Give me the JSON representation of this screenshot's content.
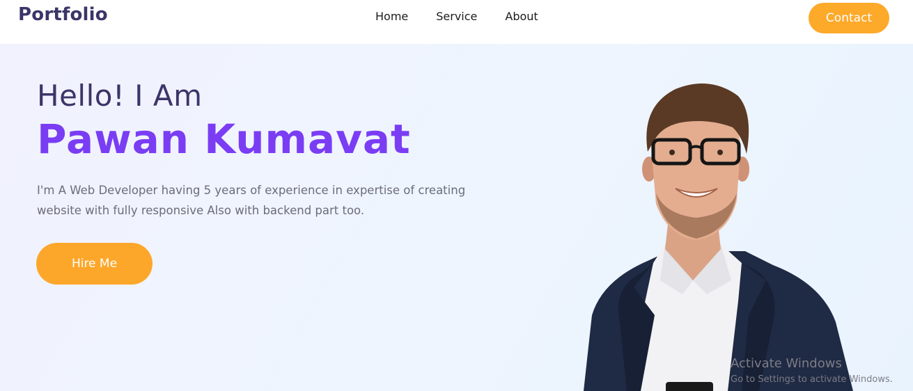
{
  "nav": {
    "brand": "Portfolio",
    "links": [
      "Home",
      "Service",
      "About"
    ],
    "contact_label": "Contact"
  },
  "hero": {
    "greeting": "Hello! I Am",
    "name": "Pawan Kumavat",
    "description": "I'm A Web Developer having 5 years of experience in expertise of creating website with fully responsive Also with backend part too.",
    "hire_label": "Hire Me"
  },
  "watermark": {
    "title": "Activate Windows",
    "subtitle": "Go to Settings to activate Windows."
  },
  "colors": {
    "brand_text": "#3b3568",
    "name_accent": "#7a3df4",
    "button_orange": "#fda92a"
  }
}
